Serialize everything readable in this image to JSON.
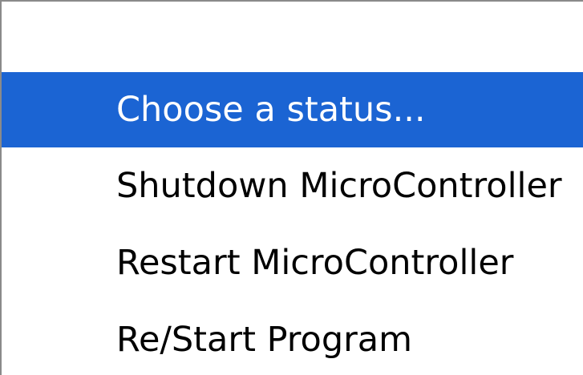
{
  "dropdown": {
    "options": [
      {
        "label": "",
        "selected": false
      },
      {
        "label": "Choose a status...",
        "selected": true
      },
      {
        "label": "Shutdown MicroController",
        "selected": false
      },
      {
        "label": "Restart MicroController",
        "selected": false
      },
      {
        "label": "Re/Start Program",
        "selected": false
      }
    ]
  },
  "colors": {
    "selected_background": "#1b64d3",
    "selected_text": "#ffffff",
    "text": "#000000",
    "border": "#8a8a8a"
  }
}
